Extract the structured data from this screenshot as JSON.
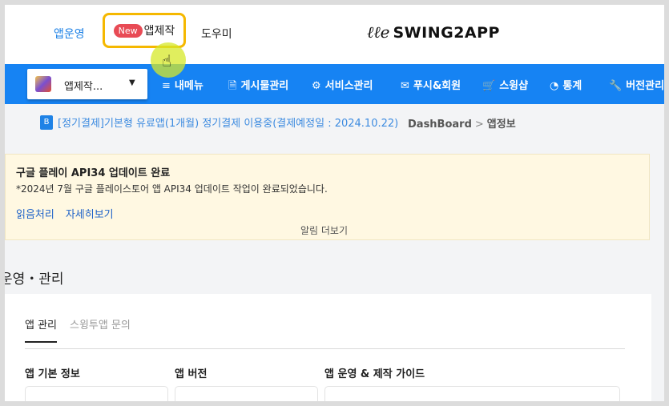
{
  "header": {
    "nav_app_operate": "앱운영",
    "nav_app_make_badge": "New",
    "nav_app_make": "앱제작",
    "nav_help": "도우미",
    "logo_text": "SWING2APP"
  },
  "menubar": {
    "app_select_label": "앱제작...",
    "items": [
      {
        "icon": "≡",
        "label": "내메뉴"
      },
      {
        "icon": "🗎",
        "label": "게시물관리"
      },
      {
        "icon": "⚙",
        "label": "서비스관리"
      },
      {
        "icon": "✉",
        "label": "푸시&회원"
      },
      {
        "icon": "🛒",
        "label": "스윙샵"
      },
      {
        "icon": "◔",
        "label": "통계"
      },
      {
        "icon": "🔧",
        "label": "버전관리"
      }
    ]
  },
  "subscription": {
    "badge": "B",
    "text": "[정기결제]기본형 유료앱(1개월) 정기결제 이용중(결제예정일 : 2024.10.22)"
  },
  "breadcrumb": {
    "root": "DashBoard",
    "separator": ">",
    "current": "앱정보"
  },
  "notice": {
    "title": "구글 플레이 API34 업데이트 완료",
    "body": "*2024년 7월 구글 플레이스토어 앱 API34 업데이트 작업이 완료되었습니다.",
    "link_read": "읽음처리",
    "link_detail": "자세히보기",
    "more": "알림 더보기"
  },
  "section": {
    "title": "운영・관리",
    "tabs": [
      "앱 관리",
      "스윙투앱 문의"
    ],
    "columns": [
      "앱 기본 정보",
      "앱 버전",
      "앱 운영 & 제작 가이드"
    ]
  },
  "colors": {
    "brand_blue": "#1683f3",
    "highlight_border": "#f5b800",
    "badge_red": "#e84b55",
    "notice_bg": "#fff8e2"
  }
}
